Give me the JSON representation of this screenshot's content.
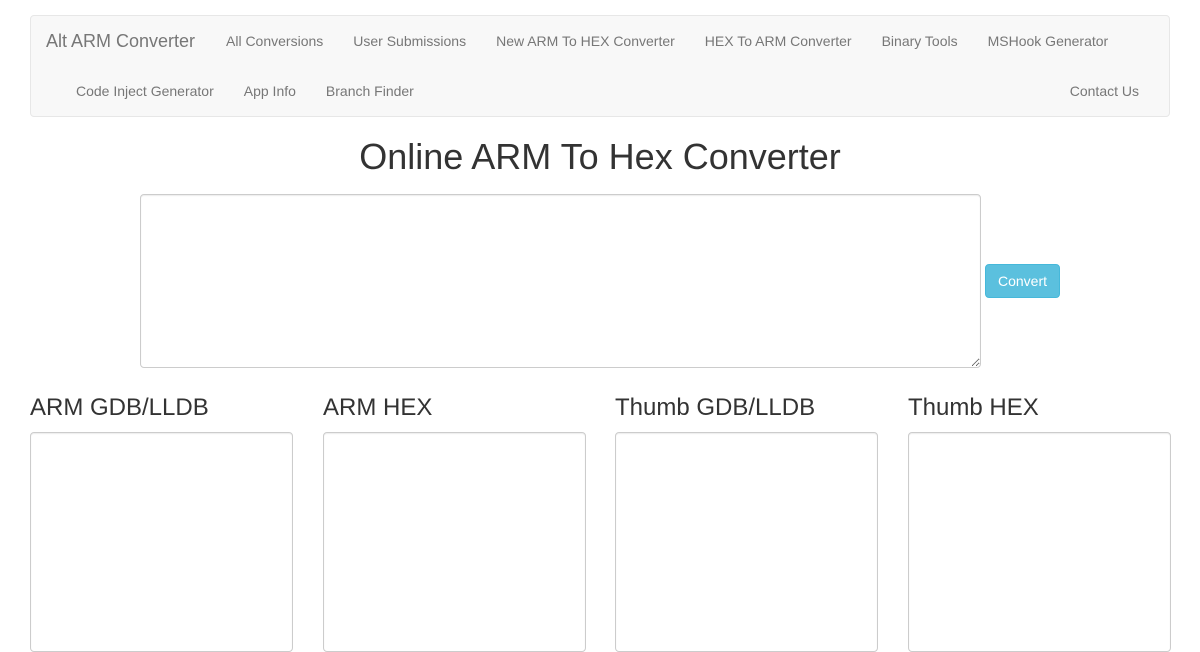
{
  "navbar": {
    "brand": "Alt ARM Converter",
    "row1": [
      "All Conversions",
      "User Submissions",
      "New ARM To HEX Converter",
      "HEX To ARM Converter",
      "Binary Tools",
      "MSHook Generator"
    ],
    "row2": [
      "Code Inject Generator",
      "App Info",
      "Branch Finder"
    ],
    "right": "Contact Us"
  },
  "main": {
    "title": "Online ARM To Hex Converter",
    "input_value": "",
    "convert_label": "Convert"
  },
  "outputs": [
    {
      "label": "ARM GDB/LLDB",
      "value": ""
    },
    {
      "label": "ARM HEX",
      "value": ""
    },
    {
      "label": "Thumb GDB/LLDB",
      "value": ""
    },
    {
      "label": "Thumb HEX",
      "value": ""
    }
  ],
  "colors": {
    "navbar_bg": "#f8f8f8",
    "button_info": "#5bc0de"
  }
}
